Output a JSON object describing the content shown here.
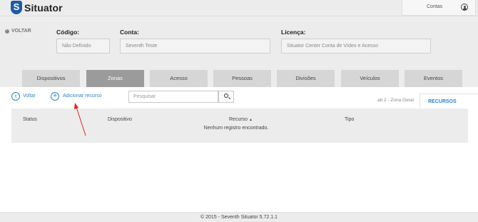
{
  "app": {
    "name": "Situator",
    "logo_letter": "S"
  },
  "account": {
    "label": "Contas",
    "icon": "user-circle-icon"
  },
  "header": {
    "back_label": "VOLTAR",
    "codigo": {
      "label": "Código:",
      "value": "Não Definido"
    },
    "conta": {
      "label": "Conta:",
      "value": "Seventh Teste"
    },
    "licenca": {
      "label": "Licença:",
      "value": "Situator Center Conta de Vídeo e Acesso"
    }
  },
  "tabs": [
    {
      "label": "Dispositivos",
      "active": false
    },
    {
      "label": "Zonas",
      "active": true
    },
    {
      "label": "Acesso",
      "active": false
    },
    {
      "label": "Pessoas",
      "active": false
    },
    {
      "label": "Divisões",
      "active": false
    },
    {
      "label": "Veículos",
      "active": false
    },
    {
      "label": "Eventos",
      "active": false
    }
  ],
  "toolbar": {
    "back_label": "Voltar",
    "add_label": "Adicionar recurso",
    "search_placeholder": "Pesquisar",
    "breadcrumb": "ab 2 - Zona Geral",
    "side_tab": "RECURSOS"
  },
  "table": {
    "columns": [
      "Status",
      "Dispositivo",
      "Recurso",
      "Tipo"
    ],
    "sort_indicator": "▲",
    "empty_message": "Nenhum registro encontrado."
  },
  "annotation": {
    "color": "#e02020"
  },
  "footer": {
    "text": "© 2015 - Seventh Situator 5.72.1.1"
  },
  "colors": {
    "accent": "#2a87c8",
    "brand": "#1e5aa8",
    "active_tab": "#9b9b9b"
  }
}
